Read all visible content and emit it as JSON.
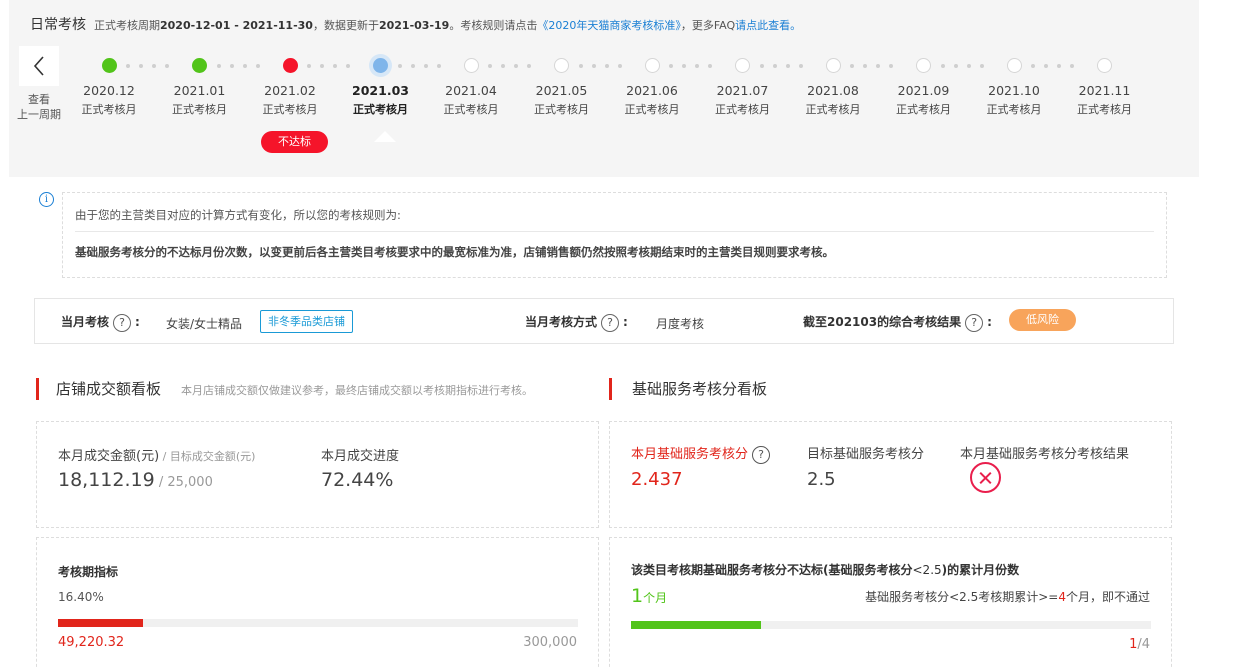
{
  "header": {
    "title": "日常考核",
    "period_prefix": "正式考核周期",
    "period": "2020-12-01 - 2021-11-30",
    "update_prefix": "，数据更新于",
    "update_date": "2021-03-19",
    "rules_prefix": "。考核规则请点击",
    "rules_link": "《2020年天猫商家考核标准》",
    "faq_prefix": "，更多FAQ",
    "faq_link": "请点此查看。"
  },
  "prev_period": {
    "line1": "查看",
    "line2": "上一周期",
    "icon": "chevron-left-icon"
  },
  "timeline": [
    {
      "date": "2020.12",
      "label": "正式考核月",
      "status": "pass"
    },
    {
      "date": "2021.01",
      "label": "正式考核月",
      "status": "pass"
    },
    {
      "date": "2021.02",
      "label": "正式考核月",
      "status": "fail"
    },
    {
      "date": "2021.03",
      "label": "正式考核月",
      "status": "current"
    },
    {
      "date": "2021.04",
      "label": "正式考核月",
      "status": "future"
    },
    {
      "date": "2021.05",
      "label": "正式考核月",
      "status": "future"
    },
    {
      "date": "2021.06",
      "label": "正式考核月",
      "status": "future"
    },
    {
      "date": "2021.07",
      "label": "正式考核月",
      "status": "future"
    },
    {
      "date": "2021.08",
      "label": "正式考核月",
      "status": "future"
    },
    {
      "date": "2021.09",
      "label": "正式考核月",
      "status": "future"
    },
    {
      "date": "2021.10",
      "label": "正式考核月",
      "status": "future"
    },
    {
      "date": "2021.11",
      "label": "正式考核月",
      "status": "future"
    }
  ],
  "fail_badge": "不达标",
  "notice": {
    "line1": "由于您的主营类目对应的计算方式有变化，所以您的考核规则为:",
    "line2": "基础服务考核分的不达标月份次数，以变更前后各主营类目考核要求中的最宽标准为准，店铺销售额仍然按照考核期结束时的主营类目规则要求考核。"
  },
  "status_row": {
    "month_label": "当月考核",
    "month_value": "女装/女士精品",
    "month_tag": "非冬季品类店铺",
    "method_label": "当月考核方式",
    "method_value": "月度考核",
    "result_label": "截至202103的综合考核结果",
    "result_badge": "低风险",
    "colon": ":"
  },
  "sales_board": {
    "title": "店铺成交额看板",
    "desc": "本月店铺成交额仅做建议参考，最终店铺成交额以考核期指标进行考核。",
    "amount_label": "本月成交金额(元)",
    "target_label": "目标成交金额(元)",
    "amount": "18,112.19",
    "target": "25,000",
    "progress_label": "本月成交进度",
    "progress": "72.44%",
    "period_title": "考核期指标",
    "period_percent": "16.40%",
    "period_fraction": 0.164,
    "period_current": "49,220.32",
    "period_total": "300,000"
  },
  "service_board": {
    "title": "基础服务考核分看板",
    "score_label": "本月基础服务考核分",
    "score": "2.437",
    "target_label": "目标基础服务考核分",
    "target": "2.5",
    "result_label": "本月基础服务考核分考核结果",
    "result_icon": "fail-x-icon",
    "fail_title_a": "该类目考核期基础服务考核分不达标(基础服务考核分",
    "fail_title_b": "<2.5",
    "fail_title_c": ")的累计月份数",
    "months_value": "1",
    "months_unit": "个月",
    "rule_a": "基础服务考核分<2.5考核期累计>=",
    "rule_num": "4",
    "rule_b": "个月，即不通过",
    "count_current": "1",
    "count_total": "/4",
    "count_fraction": 0.25
  },
  "colors": {
    "green": "#52c41a",
    "red": "#e1251b",
    "blue": "#1a7fd4",
    "orange": "#f8a45b"
  }
}
